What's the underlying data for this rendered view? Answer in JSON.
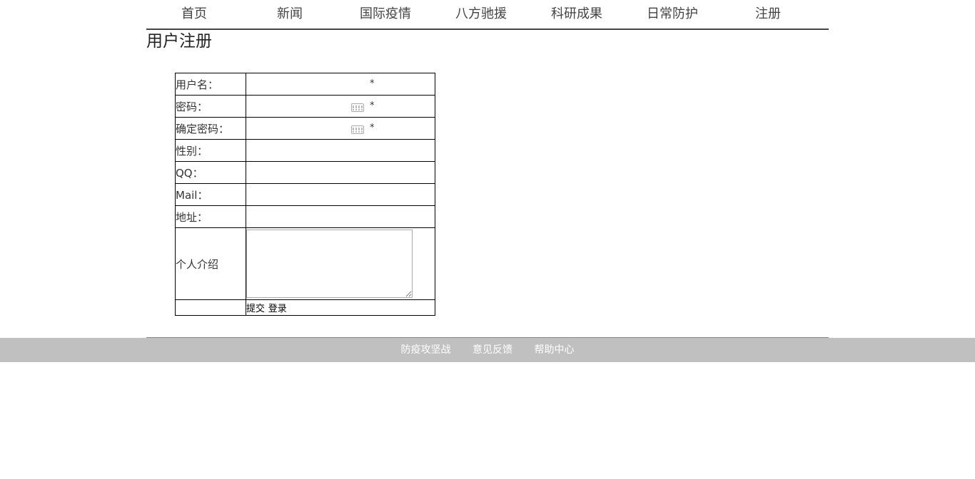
{
  "nav": {
    "items": [
      {
        "label": "首页"
      },
      {
        "label": "新闻"
      },
      {
        "label": "国际疫情"
      },
      {
        "label": "八方驰援"
      },
      {
        "label": "科研成果"
      },
      {
        "label": "日常防护"
      },
      {
        "label": "注册"
      }
    ]
  },
  "page": {
    "title": "用户注册"
  },
  "form": {
    "username_label": "用户名：",
    "password_label": "密码：",
    "confirm_label": "确定密码：",
    "gender_label": "性别：",
    "qq_label": "QQ：",
    "mail_label": "Mail：",
    "address_label": "地址：",
    "intro_label": "个人介绍",
    "required_mark": "*",
    "submit_label": "提交",
    "login_label": "登录"
  },
  "footer": {
    "links": [
      {
        "label": "防疫攻坚战"
      },
      {
        "label": "意见反馈"
      },
      {
        "label": "帮助中心"
      }
    ]
  }
}
